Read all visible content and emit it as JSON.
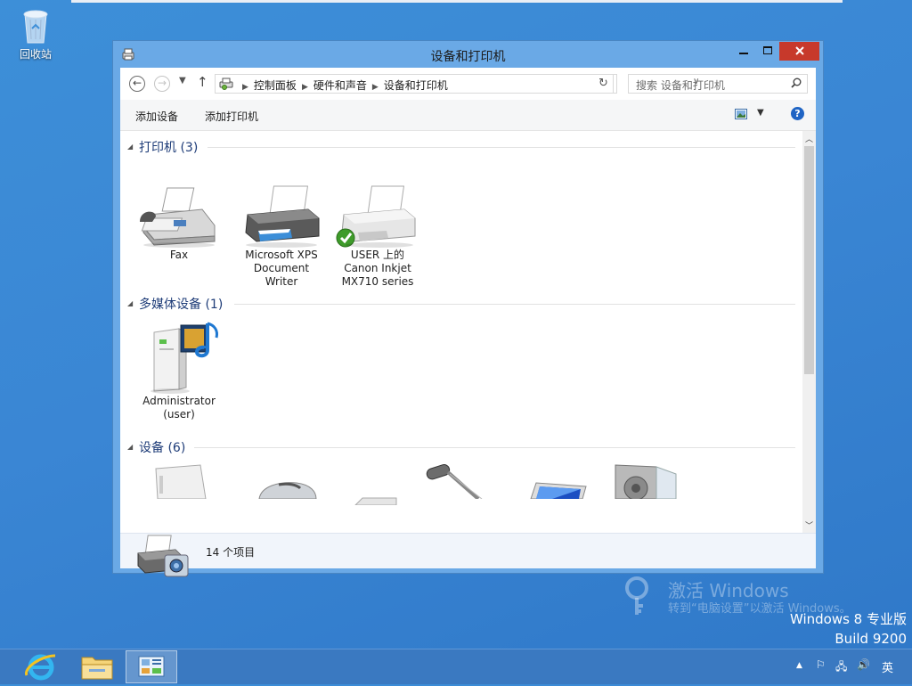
{
  "desktop": {
    "recycle_bin_label": "回收站"
  },
  "watermark": {
    "activate_title": "激活 Windows",
    "activate_sub": "转到“电脑设置”以激活 Windows。",
    "edition": "Windows 8 专业版",
    "build": "Build 9200"
  },
  "window": {
    "title": "设备和打印机",
    "breadcrumbs": [
      "控制面板",
      "硬件和声音",
      "设备和打印机"
    ],
    "search_placeholder": "搜索 设备和打印机",
    "commands": {
      "add_device": "添加设备",
      "add_printer": "添加打印机"
    },
    "help_label": "?",
    "groups": {
      "printers": {
        "title": "打印机 (3)",
        "items": [
          {
            "label_lines": [
              "Fax"
            ]
          },
          {
            "label_lines": [
              "Microsoft XPS",
              "Document",
              "Writer"
            ]
          },
          {
            "label_lines": [
              "USER 上的",
              "Canon Inkjet",
              "MX710 series"
            ]
          }
        ]
      },
      "multimedia": {
        "title": "多媒体设备 (1)",
        "items": [
          {
            "label_lines": [
              "Administrator",
              "(user)"
            ]
          }
        ]
      },
      "devices": {
        "title": "设备 (6)"
      }
    },
    "details": {
      "item_count": "14 个项目"
    }
  },
  "taskbar": {
    "ime_label": "英"
  },
  "colors": {
    "accent": "#3a86d4",
    "close": "#c7392b",
    "group_title": "#1e3c78",
    "taskbar": "#3a79c1"
  }
}
